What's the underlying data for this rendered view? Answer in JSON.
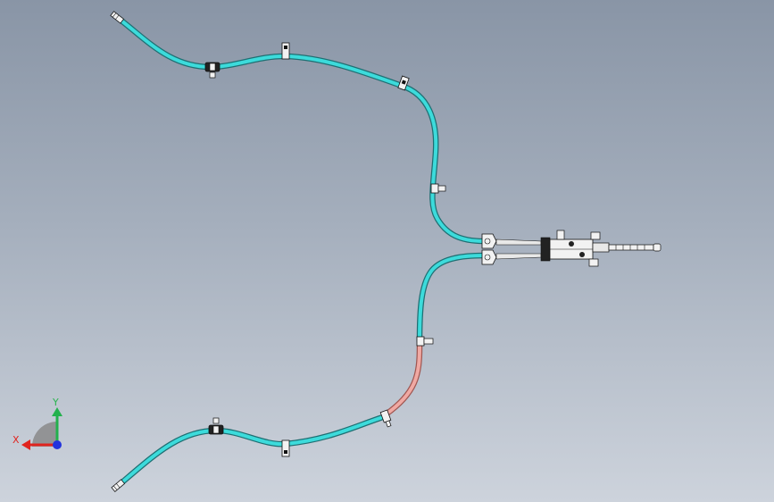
{
  "colors": {
    "hose": "#3cdbdb",
    "hose_outline": "#1f6f73",
    "hose_heated": "#f0a9a3",
    "hose_heated_outline": "#a05752",
    "line": "#1a1a1a",
    "part_fill": "#f2f2f2",
    "axis_x": "#e0241f",
    "axis_y": "#23b14d",
    "axis_z": "#2233dd"
  },
  "triad": {
    "x_label": "X",
    "y_label": "Y"
  },
  "icons": [
    "hose-clip-icon",
    "connector-icon",
    "end-fitting-icon",
    "valve-assembly-icon",
    "axis-triad-icon"
  ]
}
